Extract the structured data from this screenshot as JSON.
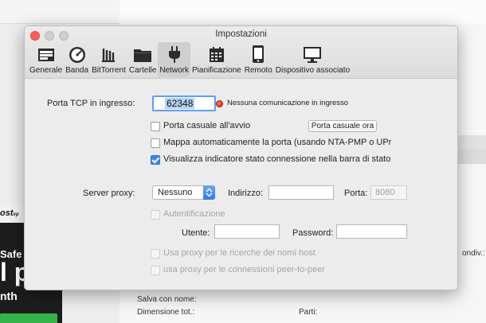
{
  "background": {
    "ad": {
      "brand": "ost",
      "brand_suffix": "vp",
      "line1": "Safe",
      "line2": "l p",
      "line3": "nth"
    },
    "labels": {
      "salva": "Salva con nome:",
      "dimensione": "Dimensione tot.:",
      "parti": "Parti:",
      "condiv": "ondiv.:"
    }
  },
  "dialog": {
    "title": "Impostazioni",
    "tabs": [
      {
        "label": "Generale",
        "icon": "general-icon"
      },
      {
        "label": "Banda",
        "icon": "speedometer-icon"
      },
      {
        "label": "BitTorrent",
        "icon": "bittorrent-icon"
      },
      {
        "label": "Cartelle",
        "icon": "folder-icon"
      },
      {
        "label": "Network",
        "icon": "plug-icon",
        "active": true
      },
      {
        "label": "Pianificazione",
        "icon": "calendar-icon"
      },
      {
        "label": "Remoto",
        "icon": "phone-icon"
      },
      {
        "label": "Dispositivo associato",
        "icon": "monitor-icon"
      }
    ],
    "network": {
      "port_label": "Porta TCP in ingresso:",
      "port_value": "62348",
      "status_text": "Nessuna comunicazione in ingresso",
      "random_port_label": "Porta casuale all'avvio",
      "random_port_button": "Porta casuale ora",
      "map_port_label": "Mappa automaticamente la porta (usando NTA-PMP o UPr",
      "show_indicator_label": "Visualizza indicatore stato connessione nella barra di stato",
      "proxy_label": "Server proxy:",
      "proxy_value": "Nessuno",
      "address_label": "Indirizzo:",
      "port_field_label": "Porta:",
      "proxy_port_placeholder": "8080",
      "auth_label": "Autentificazione",
      "user_label": "Utente:",
      "password_label": "Password:",
      "proxy_dns_label": "Usa proxy per le ricerche dei nomi host",
      "proxy_p2p_label": "usa proxy per le connessioni peer-to-peer"
    }
  }
}
